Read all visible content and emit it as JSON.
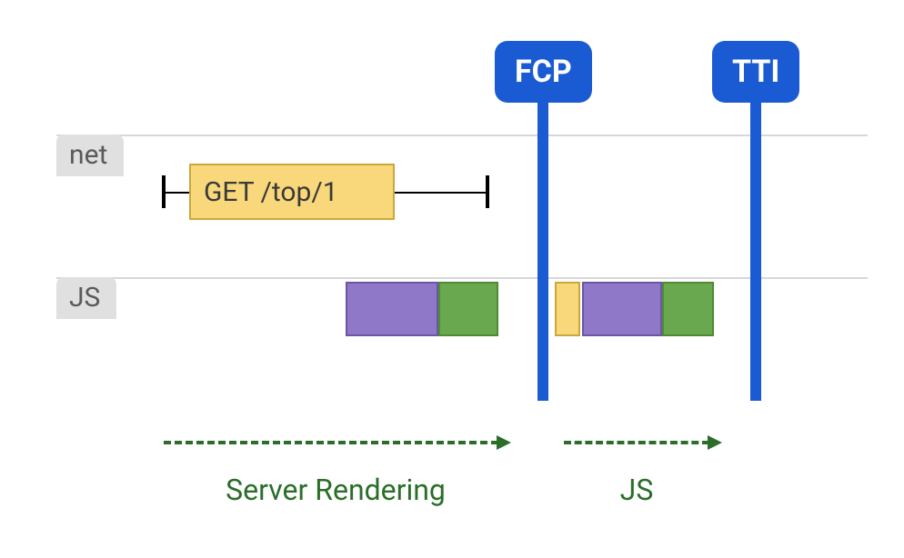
{
  "lanes": {
    "net": "net",
    "js": "JS"
  },
  "flags": {
    "fcp": "FCP",
    "tti": "TTI"
  },
  "net": {
    "request_label": "GET /top/1"
  },
  "phases": {
    "server": "Server Rendering",
    "js": "JS"
  },
  "colors": {
    "flag": "#1a5bd4",
    "purple": "#8e78c7",
    "green": "#6aa84f",
    "yellow": "#f9d77b",
    "phase": "#2a6e2a"
  }
}
